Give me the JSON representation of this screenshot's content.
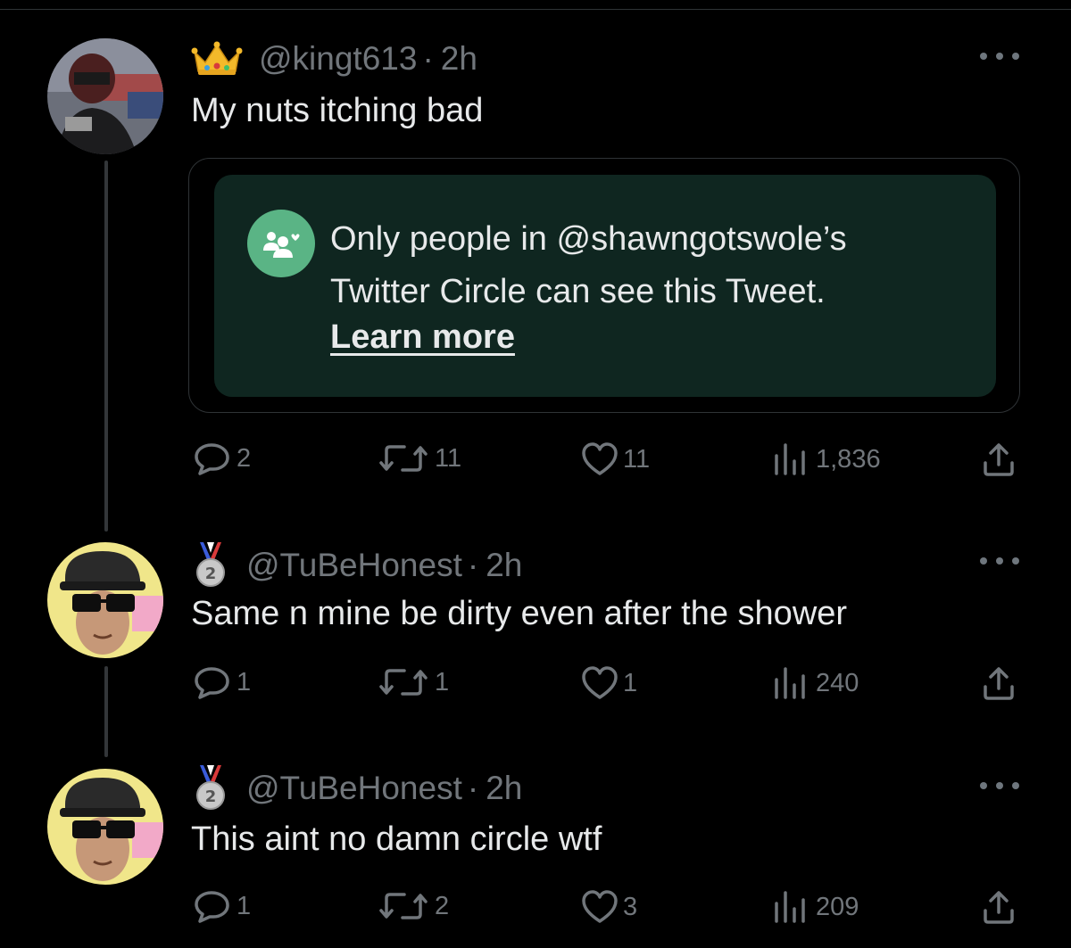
{
  "tweets": [
    {
      "handle": "@kingt613",
      "sep": "·",
      "time": "2h",
      "badge_icon": "crown-icon",
      "text": "My nuts itching bad",
      "stats": {
        "replies": "2",
        "retweets": "11",
        "likes": "11",
        "views": "1,836"
      }
    },
    {
      "handle": "@TuBeHonest",
      "sep": "·",
      "time": "2h",
      "badge_icon": "second-place-medal-icon",
      "text": "Same n mine be dirty even after the shower",
      "stats": {
        "replies": "1",
        "retweets": "1",
        "likes": "1",
        "views": "240"
      }
    },
    {
      "handle": "@TuBeHonest",
      "sep": "·",
      "time": "2h",
      "badge_icon": "second-place-medal-icon",
      "text": "This aint no damn circle wtf",
      "stats": {
        "replies": "1",
        "retweets": "2",
        "likes": "3",
        "views": "209"
      }
    }
  ],
  "circle_notice": {
    "icon": "twitter-circle-icon",
    "line1": "Only people in @shawngotswole’s",
    "line2": "Twitter Circle can see this Tweet.",
    "link": "Learn more"
  },
  "colors": {
    "background": "#000000",
    "muted_text": "#71767b",
    "primary_text": "#e7e9ea",
    "circle_bg": "#0f2620",
    "circle_icon": "#5ab485"
  }
}
